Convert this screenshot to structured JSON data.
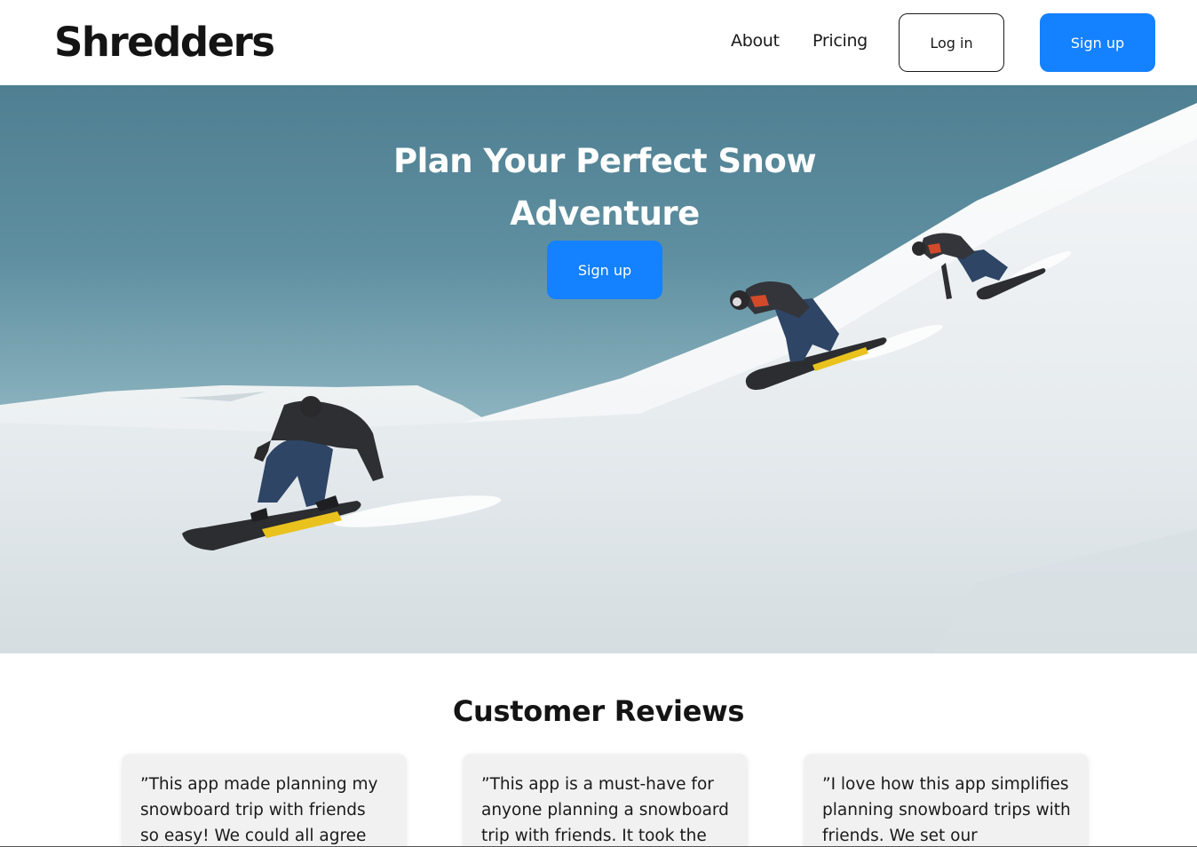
{
  "header": {
    "logo": "Shredders",
    "nav": [
      {
        "label": "About"
      },
      {
        "label": "Pricing"
      }
    ],
    "login_label": "Log in",
    "signup_label": "Sign up"
  },
  "hero": {
    "title": "Plan Your Perfect Snow Adventure",
    "cta_label": "Sign up"
  },
  "reviews": {
    "title": "Customer Reviews",
    "items": [
      {
        "text": "”This app made planning my snowboard trip with friends so easy! We could all agree on"
      },
      {
        "text": "”This app is a must-have for anyone planning a snowboard trip with friends. It took the"
      },
      {
        "text": "”I love how this app simplifies planning snowboard trips with friends. We set our"
      }
    ]
  },
  "colors": {
    "accent": "#1481ff",
    "text": "#141414",
    "card_bg": "#f1f1f1"
  }
}
